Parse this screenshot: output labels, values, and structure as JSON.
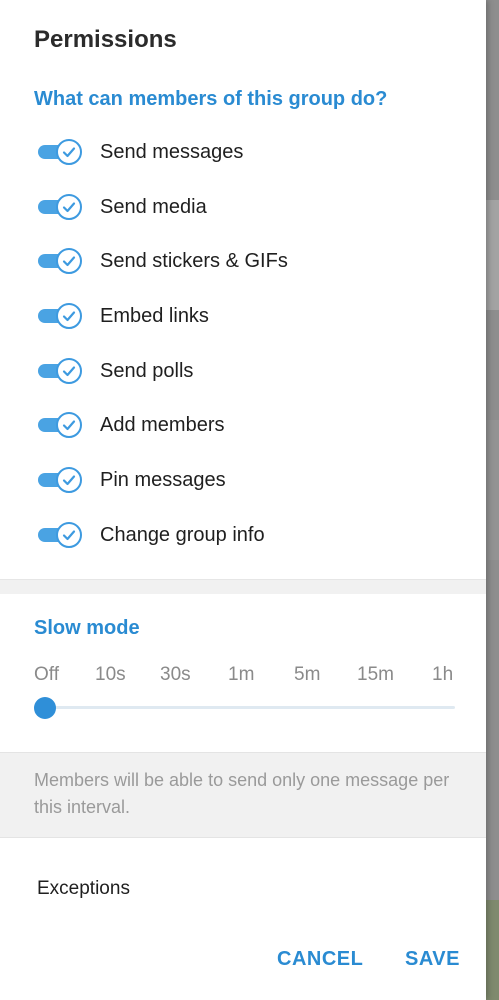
{
  "dialog": {
    "title": "Permissions"
  },
  "permissions": {
    "section_title": "What can members of this group do?",
    "items": [
      {
        "label": "Send messages",
        "enabled": true
      },
      {
        "label": "Send media",
        "enabled": true
      },
      {
        "label": "Send stickers & GIFs",
        "enabled": true
      },
      {
        "label": "Embed links",
        "enabled": true
      },
      {
        "label": "Send polls",
        "enabled": true
      },
      {
        "label": "Add members",
        "enabled": true
      },
      {
        "label": "Pin messages",
        "enabled": true
      },
      {
        "label": "Change group info",
        "enabled": true
      }
    ]
  },
  "slow_mode": {
    "section_title": "Slow mode",
    "ticks": [
      "Off",
      "10s",
      "30s",
      "1m",
      "5m",
      "15m",
      "1h"
    ],
    "selected": "Off",
    "info": "Members will be able to send only one message per this interval."
  },
  "exceptions": {
    "label": "Exceptions"
  },
  "actions": {
    "cancel_label": "CANCEL",
    "save_label": "SAVE"
  },
  "colors": {
    "accent": "#2a8bd2",
    "toggle_track": "#4aa3e3",
    "info_background": "#f1f1f1"
  },
  "icons": {
    "toggle_check": "check-icon"
  }
}
